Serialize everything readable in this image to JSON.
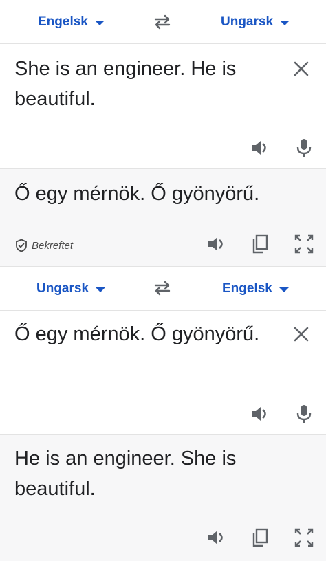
{
  "top": {
    "source_lang": "Engelsk",
    "target_lang": "Ungarsk",
    "input_text": "She is an engineer. He is beautiful.",
    "output_text": "Ő egy mérnök. Ő gyönyörű.",
    "verify_label": "Bekreftet"
  },
  "bottom": {
    "source_lang": "Ungarsk",
    "target_lang": "Engelsk",
    "input_text": "Ő egy mérnök. Ő gyönyörű.",
    "output_text": "He is an engineer. She is beautiful."
  },
  "colors": {
    "accent": "#1a56c4",
    "icon": "#5f6368",
    "output_bg": "#f7f7f8"
  }
}
